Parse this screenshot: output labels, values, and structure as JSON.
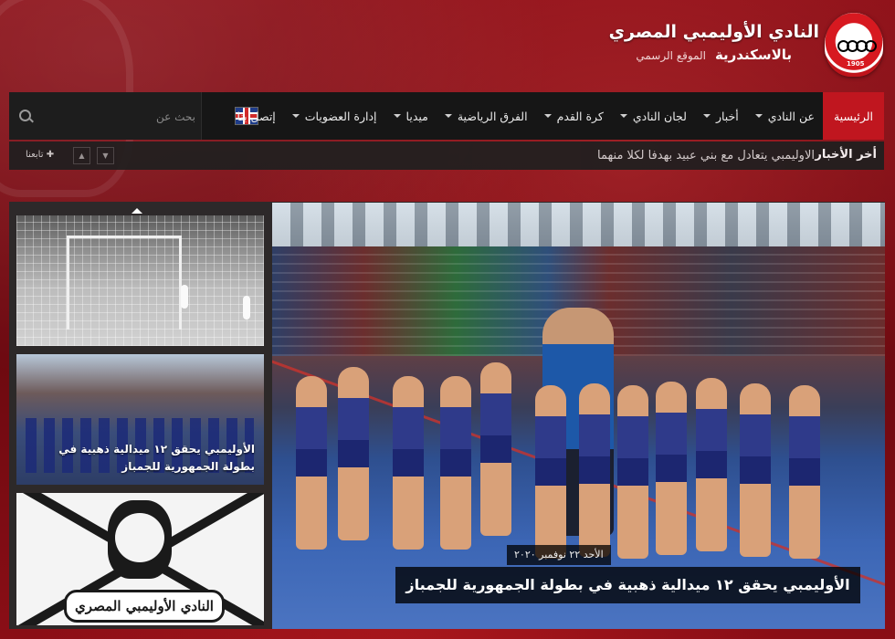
{
  "header": {
    "title": "النادي الأوليمبي المصري",
    "city": "بالاسكندرية",
    "tagline": "الموقع الرسمي",
    "logo_text": "OLYMPIC CLUB",
    "logo_year": "1905"
  },
  "nav": {
    "items": [
      {
        "label": "الرئيسية",
        "active": true,
        "has_dropdown": false
      },
      {
        "label": "عن النادي",
        "has_dropdown": true
      },
      {
        "label": "أخبار",
        "has_dropdown": true
      },
      {
        "label": "لجان النادي",
        "has_dropdown": true
      },
      {
        "label": "كرة القدم",
        "has_dropdown": true
      },
      {
        "label": "الفرق الرياضية",
        "has_dropdown": true
      },
      {
        "label": "ميديا",
        "has_dropdown": true
      },
      {
        "label": "إدارة العضويات",
        "has_dropdown": true
      },
      {
        "label": "إتصل بنا",
        "has_dropdown": false
      }
    ],
    "language_flag": "uk-flag-icon",
    "search": {
      "placeholder": "بحث عن"
    }
  },
  "ticker": {
    "label": "أخر الأخبار",
    "headline": "الاوليمبي يتعادل مع بني عبيد بهدفا لكلا منهما",
    "follow_label": "تابعنا"
  },
  "slider": {
    "featured": {
      "date": "الأحد ٢٢ نوفمبر ٢٠٢٠",
      "caption": "الأوليمبي يحقق ١٢ ميدالية ذهبية في بطولة الجمهورية للجمباز"
    },
    "thumbnails": [
      {
        "caption": ""
      },
      {
        "caption": "الأوليمبي يحقق ١٢ ميدالية ذهبية في بطولة الجمهورية للجمباز"
      },
      {
        "caption": "النادي الأوليمبي المصري"
      }
    ]
  },
  "colors": {
    "brand_red": "#c0161f",
    "navbar_bg": "#161616",
    "background": "#7e0a12"
  }
}
